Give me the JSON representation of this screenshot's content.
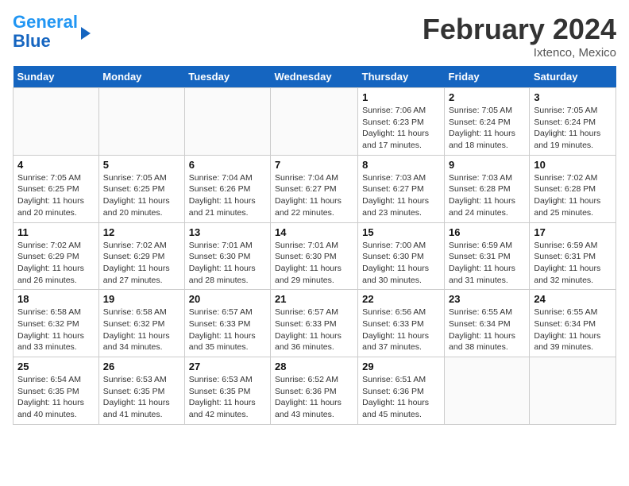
{
  "header": {
    "logo_line1": "General",
    "logo_line2": "Blue",
    "month": "February 2024",
    "location": "Ixtenco, Mexico"
  },
  "weekdays": [
    "Sunday",
    "Monday",
    "Tuesday",
    "Wednesday",
    "Thursday",
    "Friday",
    "Saturday"
  ],
  "weeks": [
    [
      {
        "num": "",
        "info": ""
      },
      {
        "num": "",
        "info": ""
      },
      {
        "num": "",
        "info": ""
      },
      {
        "num": "",
        "info": ""
      },
      {
        "num": "1",
        "info": "Sunrise: 7:06 AM\nSunset: 6:23 PM\nDaylight: 11 hours and 17 minutes."
      },
      {
        "num": "2",
        "info": "Sunrise: 7:05 AM\nSunset: 6:24 PM\nDaylight: 11 hours and 18 minutes."
      },
      {
        "num": "3",
        "info": "Sunrise: 7:05 AM\nSunset: 6:24 PM\nDaylight: 11 hours and 19 minutes."
      }
    ],
    [
      {
        "num": "4",
        "info": "Sunrise: 7:05 AM\nSunset: 6:25 PM\nDaylight: 11 hours and 20 minutes."
      },
      {
        "num": "5",
        "info": "Sunrise: 7:05 AM\nSunset: 6:25 PM\nDaylight: 11 hours and 20 minutes."
      },
      {
        "num": "6",
        "info": "Sunrise: 7:04 AM\nSunset: 6:26 PM\nDaylight: 11 hours and 21 minutes."
      },
      {
        "num": "7",
        "info": "Sunrise: 7:04 AM\nSunset: 6:27 PM\nDaylight: 11 hours and 22 minutes."
      },
      {
        "num": "8",
        "info": "Sunrise: 7:03 AM\nSunset: 6:27 PM\nDaylight: 11 hours and 23 minutes."
      },
      {
        "num": "9",
        "info": "Sunrise: 7:03 AM\nSunset: 6:28 PM\nDaylight: 11 hours and 24 minutes."
      },
      {
        "num": "10",
        "info": "Sunrise: 7:02 AM\nSunset: 6:28 PM\nDaylight: 11 hours and 25 minutes."
      }
    ],
    [
      {
        "num": "11",
        "info": "Sunrise: 7:02 AM\nSunset: 6:29 PM\nDaylight: 11 hours and 26 minutes."
      },
      {
        "num": "12",
        "info": "Sunrise: 7:02 AM\nSunset: 6:29 PM\nDaylight: 11 hours and 27 minutes."
      },
      {
        "num": "13",
        "info": "Sunrise: 7:01 AM\nSunset: 6:30 PM\nDaylight: 11 hours and 28 minutes."
      },
      {
        "num": "14",
        "info": "Sunrise: 7:01 AM\nSunset: 6:30 PM\nDaylight: 11 hours and 29 minutes."
      },
      {
        "num": "15",
        "info": "Sunrise: 7:00 AM\nSunset: 6:30 PM\nDaylight: 11 hours and 30 minutes."
      },
      {
        "num": "16",
        "info": "Sunrise: 6:59 AM\nSunset: 6:31 PM\nDaylight: 11 hours and 31 minutes."
      },
      {
        "num": "17",
        "info": "Sunrise: 6:59 AM\nSunset: 6:31 PM\nDaylight: 11 hours and 32 minutes."
      }
    ],
    [
      {
        "num": "18",
        "info": "Sunrise: 6:58 AM\nSunset: 6:32 PM\nDaylight: 11 hours and 33 minutes."
      },
      {
        "num": "19",
        "info": "Sunrise: 6:58 AM\nSunset: 6:32 PM\nDaylight: 11 hours and 34 minutes."
      },
      {
        "num": "20",
        "info": "Sunrise: 6:57 AM\nSunset: 6:33 PM\nDaylight: 11 hours and 35 minutes."
      },
      {
        "num": "21",
        "info": "Sunrise: 6:57 AM\nSunset: 6:33 PM\nDaylight: 11 hours and 36 minutes."
      },
      {
        "num": "22",
        "info": "Sunrise: 6:56 AM\nSunset: 6:33 PM\nDaylight: 11 hours and 37 minutes."
      },
      {
        "num": "23",
        "info": "Sunrise: 6:55 AM\nSunset: 6:34 PM\nDaylight: 11 hours and 38 minutes."
      },
      {
        "num": "24",
        "info": "Sunrise: 6:55 AM\nSunset: 6:34 PM\nDaylight: 11 hours and 39 minutes."
      }
    ],
    [
      {
        "num": "25",
        "info": "Sunrise: 6:54 AM\nSunset: 6:35 PM\nDaylight: 11 hours and 40 minutes."
      },
      {
        "num": "26",
        "info": "Sunrise: 6:53 AM\nSunset: 6:35 PM\nDaylight: 11 hours and 41 minutes."
      },
      {
        "num": "27",
        "info": "Sunrise: 6:53 AM\nSunset: 6:35 PM\nDaylight: 11 hours and 42 minutes."
      },
      {
        "num": "28",
        "info": "Sunrise: 6:52 AM\nSunset: 6:36 PM\nDaylight: 11 hours and 43 minutes."
      },
      {
        "num": "29",
        "info": "Sunrise: 6:51 AM\nSunset: 6:36 PM\nDaylight: 11 hours and 45 minutes."
      },
      {
        "num": "",
        "info": ""
      },
      {
        "num": "",
        "info": ""
      }
    ]
  ]
}
